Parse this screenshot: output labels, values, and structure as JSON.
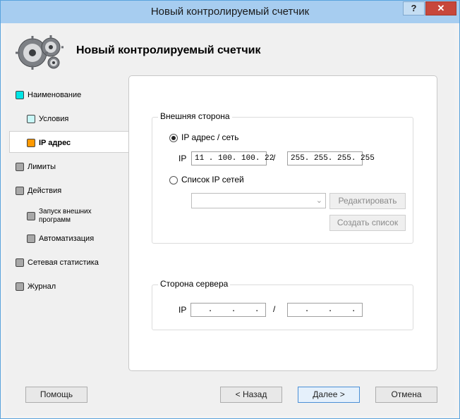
{
  "window": {
    "title": "Новый контролируемый счетчик",
    "help_button": "?",
    "close_button": "✕"
  },
  "header": {
    "title": "Новый контролируемый счетчик",
    "logo_icon": "gears-icon"
  },
  "nav": {
    "items": [
      {
        "label": "Наименование",
        "color": "#00e5e5",
        "level": 0,
        "active": false
      },
      {
        "label": "Условия",
        "color": "#c8f8f8",
        "level": 1,
        "active": false
      },
      {
        "label": "IP адрес",
        "color": "#ff9900",
        "level": 1,
        "active": true
      },
      {
        "label": "Лимиты",
        "color": "#a8a8a8",
        "level": 0,
        "active": false
      },
      {
        "label": "Действия",
        "color": "#a8a8a8",
        "level": 0,
        "active": false
      },
      {
        "label": "Запуск внешних программ",
        "color": "#a8a8a8",
        "level": 1,
        "active": false
      },
      {
        "label": "Автоматизация",
        "color": "#a8a8a8",
        "level": 1,
        "active": false
      },
      {
        "label": "Сетевая статистика",
        "color": "#a8a8a8",
        "level": 0,
        "active": false
      },
      {
        "label": "Журнал",
        "color": "#a8a8a8",
        "level": 0,
        "active": false
      }
    ]
  },
  "external_side": {
    "group_label": "Внешняя сторона",
    "radio_ip_label": "IP адрес / сеть",
    "radio_ip_checked": true,
    "ip_label": "IP",
    "ip_value": "11 . 100. 100. 22",
    "separator": "/",
    "mask_value": "255. 255. 255. 255",
    "radio_list_label": "Список IP сетей",
    "radio_list_checked": false,
    "list_value": "",
    "edit_button": "Редактировать",
    "create_list_button": "Создать список"
  },
  "server_side": {
    "group_label": "Сторона сервера",
    "ip_label": "IP",
    "ip_value": "   .    .    .",
    "separator": "/",
    "mask_value": "   .    .    ."
  },
  "footer": {
    "help_button": "Помощь",
    "back_button": "< Назад",
    "next_button": "Далее >",
    "cancel_button": "Отмена"
  }
}
